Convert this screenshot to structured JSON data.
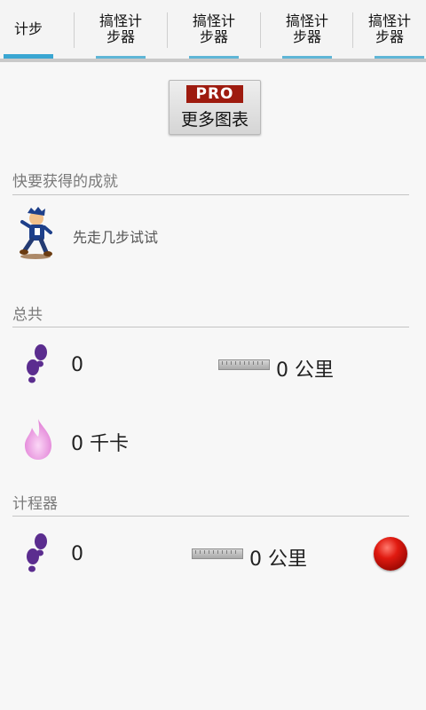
{
  "tabs": [
    {
      "label": "计步"
    },
    {
      "label": "搞怪计步器"
    },
    {
      "label": "搞怪计步器"
    },
    {
      "label": "搞怪计步器"
    },
    {
      "label": "搞怪计步器"
    }
  ],
  "pro_button": {
    "badge": "PRO",
    "label": "更多图表"
  },
  "achievements": {
    "title": "快要获得的成就",
    "item_text": "先走几步试试",
    "icon": "walking-man-icon"
  },
  "totals": {
    "title": "总共",
    "steps": "0",
    "distance": "0 公里",
    "calories": "0 千卡"
  },
  "pedometer": {
    "title": "计程器",
    "steps": "0",
    "distance": "0 公里"
  },
  "colors": {
    "footprint": "#5b2d8f",
    "flame": "#e994e0",
    "tab_indicator": "#3aa6d2",
    "pro_badge": "#9e1b0f",
    "record": "#d6160d"
  }
}
